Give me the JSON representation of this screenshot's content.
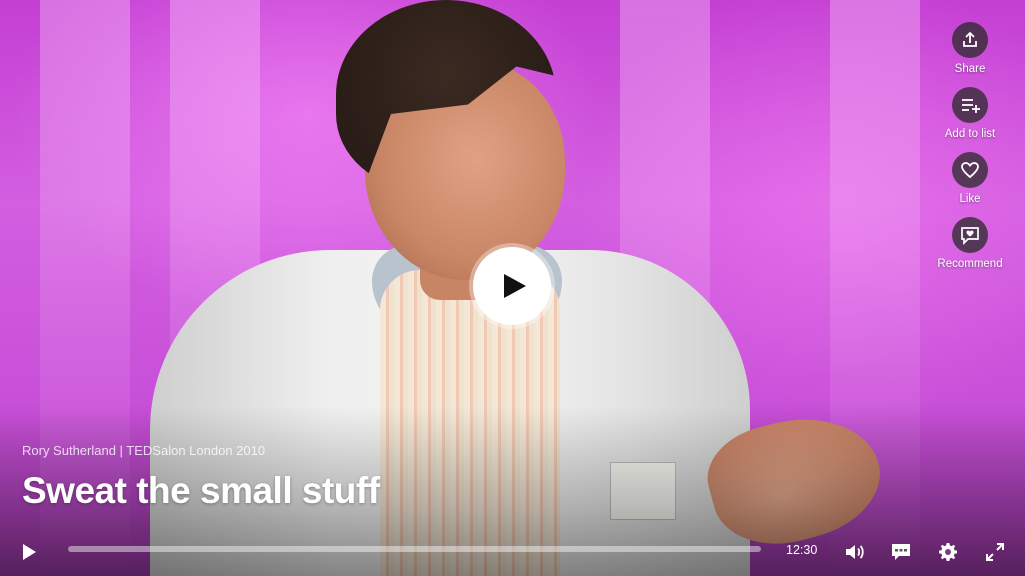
{
  "video": {
    "speaker_event": "Rory Sutherland | TEDSalon London 2010",
    "title": "Sweat the small stuff",
    "progress_fraction": 0.0
  },
  "actions": [
    {
      "label": "Share",
      "icon": "share-icon"
    },
    {
      "label": "Add to list",
      "icon": "add-to-list-icon"
    },
    {
      "label": "Like",
      "icon": "heart-icon"
    },
    {
      "label": "Recommend",
      "icon": "recommend-icon"
    }
  ],
  "controls": {
    "duration": "12:30",
    "play_icon": "play-icon",
    "volume_icon": "volume-icon",
    "captions_icon": "captions-icon",
    "settings_icon": "gear-icon",
    "fullscreen_icon": "fullscreen-icon"
  },
  "colors": {
    "stage_background": "#c84fd8",
    "control_foreground": "#ffffff"
  }
}
